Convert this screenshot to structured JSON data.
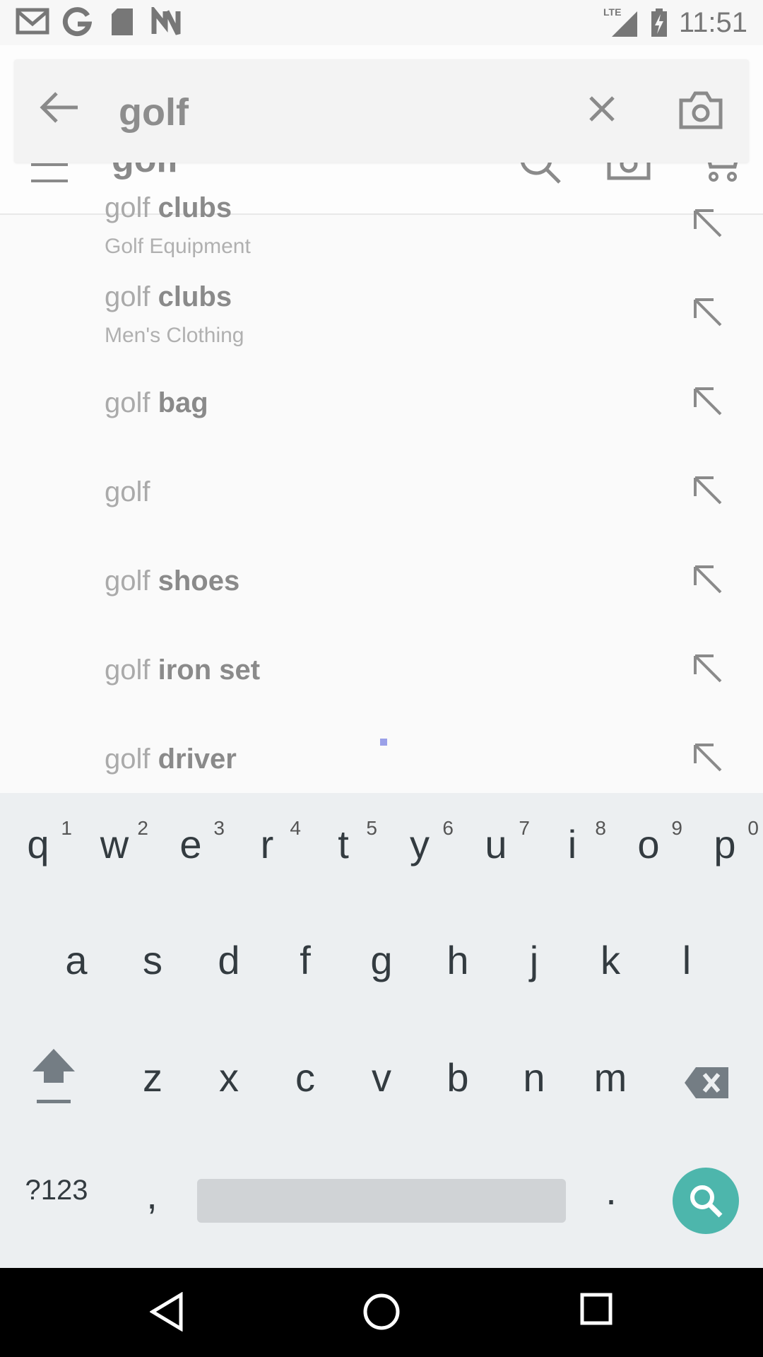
{
  "status_bar": {
    "time": "11:51",
    "network": "LTE",
    "icons": [
      "gmail-icon",
      "google-icon",
      "sd-card-icon",
      "n-icon",
      "signal-icon",
      "battery-charging-icon"
    ]
  },
  "app_toolbar": {
    "title": "golf",
    "icons": [
      "menu-icon",
      "search-icon",
      "camera-icon",
      "cart-icon"
    ]
  },
  "search": {
    "value": "golf",
    "placeholder": "",
    "icons": [
      "back-arrow-icon",
      "clear-icon",
      "camera-icon"
    ]
  },
  "suggestions": [
    {
      "prefix": "golf",
      "bold": " clubs",
      "subtitle": "Golf Equipment"
    },
    {
      "prefix": "golf",
      "bold": " clubs",
      "subtitle": "Men's Clothing"
    },
    {
      "prefix": "golf",
      "bold": " bag",
      "subtitle": ""
    },
    {
      "prefix": "golf",
      "bold": "",
      "subtitle": ""
    },
    {
      "prefix": "golf",
      "bold": " shoes",
      "subtitle": ""
    },
    {
      "prefix": "golf",
      "bold": " iron set",
      "subtitle": ""
    },
    {
      "prefix": "golf",
      "bold": " driver",
      "subtitle": ""
    }
  ],
  "keyboard": {
    "row1": [
      {
        "key": "q",
        "hint": "1"
      },
      {
        "key": "w",
        "hint": "2"
      },
      {
        "key": "e",
        "hint": "3"
      },
      {
        "key": "r",
        "hint": "4"
      },
      {
        "key": "t",
        "hint": "5"
      },
      {
        "key": "y",
        "hint": "6"
      },
      {
        "key": "u",
        "hint": "7"
      },
      {
        "key": "i",
        "hint": "8"
      },
      {
        "key": "o",
        "hint": "9"
      },
      {
        "key": "p",
        "hint": "0"
      }
    ],
    "row2": [
      "a",
      "s",
      "d",
      "f",
      "g",
      "h",
      "j",
      "k",
      "l"
    ],
    "row3": [
      "z",
      "x",
      "c",
      "v",
      "b",
      "n",
      "m"
    ],
    "symbols_label": "?123",
    "comma": ",",
    "period": ".",
    "icons": [
      "shift-icon",
      "backspace-icon",
      "search-icon"
    ],
    "accent_color": "#4db6ac"
  },
  "nav_bar": {
    "icons": [
      "back-icon",
      "home-icon",
      "recents-icon"
    ]
  }
}
